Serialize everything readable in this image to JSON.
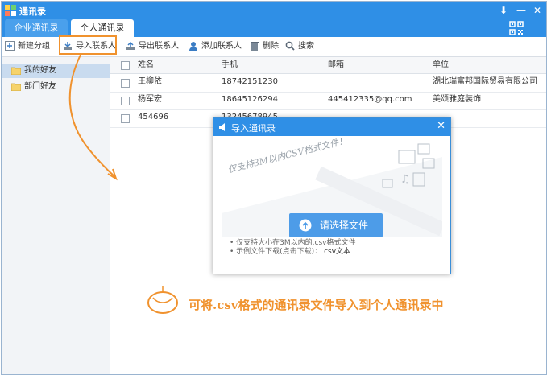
{
  "window": {
    "title": "通讯录",
    "controls": [
      "arrow-down-icon",
      "minimize-icon",
      "close-icon"
    ]
  },
  "tabs": [
    {
      "label": "企业通讯录",
      "active": false
    },
    {
      "label": "个人通讯录",
      "active": true
    }
  ],
  "toolbar": {
    "new_group": "新建分组",
    "import": "导入联系人",
    "export": "导出联系人",
    "add": "添加联系人",
    "delete": "删除",
    "search": "搜索"
  },
  "sidebar": {
    "items": [
      {
        "label": "我的好友",
        "selected": true
      },
      {
        "label": "部门好友",
        "selected": false
      }
    ]
  },
  "table": {
    "columns": [
      "姓名",
      "手机",
      "邮箱",
      "单位"
    ],
    "rows": [
      {
        "name": "王柳依",
        "phone": "18742151230",
        "email": "",
        "company": "湖北瑞富邦国际贸易有限公司"
      },
      {
        "name": "杨军宏",
        "phone": "18645126294",
        "email": "445412335@qq.com",
        "company": "美颂雅庭装饰"
      },
      {
        "name": "454696",
        "phone": "13245678945",
        "email": "",
        "company": ""
      }
    ]
  },
  "dialog": {
    "title": "导入通讯录",
    "handwriting": "仅支持3M以内CSV格式文件！",
    "button": "请选择文件",
    "tip1": "• 仅支持大小在3M以内的.csv格式文件",
    "tip2": "• 示例文件下载(点击下载)：",
    "tip2_link": "csv文本"
  },
  "caption": "可将.csv格式的通讯录文件导入到个人通讯录中",
  "colors": {
    "brand_blue": "#2f8fe6",
    "highlight_orange": "#f0922e",
    "button_blue": "#4d9ce8"
  }
}
